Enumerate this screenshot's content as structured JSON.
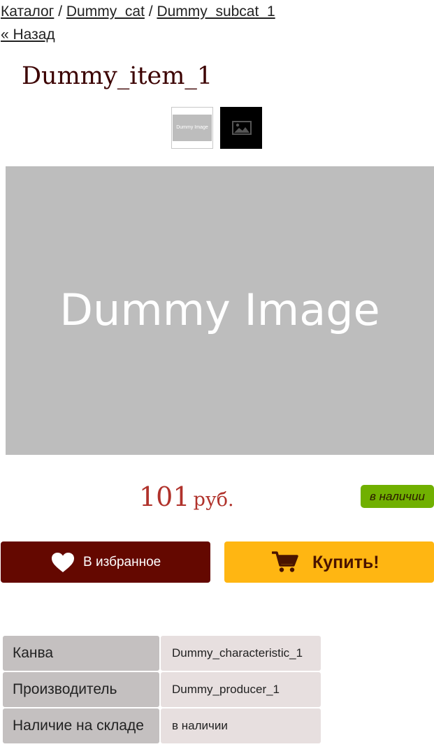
{
  "breadcrumb": {
    "items": [
      "Каталог",
      "Dummy_cat",
      "Dummy_subcat_1"
    ],
    "separator": "/"
  },
  "back_link": "« Назад",
  "product": {
    "title": "Dummy_item_1",
    "thumbnails": [
      {
        "label": "Dummy Image",
        "icon": "dummy-image-thumbnail"
      },
      {
        "label": "",
        "icon": "image-placeholder-icon"
      }
    ],
    "main_image_text": "Dummy Image",
    "price": {
      "value": "101",
      "currency": "руб."
    },
    "stock_badge": "в наличии"
  },
  "actions": {
    "favorite_label": "В избранное",
    "buy_label": "Купить!"
  },
  "characteristics": [
    {
      "name": "Канва",
      "value": "Dummy_characteristic_1"
    },
    {
      "name": "Производитель",
      "value": "Dummy_producer_1"
    },
    {
      "name": "Наличие на складе",
      "value": "в наличии"
    }
  ],
  "colors": {
    "title": "#3b0000",
    "price": "#b0322b",
    "stock_badge": "#70b000",
    "favorite_button": "#640800",
    "buy_button": "#ffb612",
    "image_placeholder": "#bdbdbd"
  }
}
